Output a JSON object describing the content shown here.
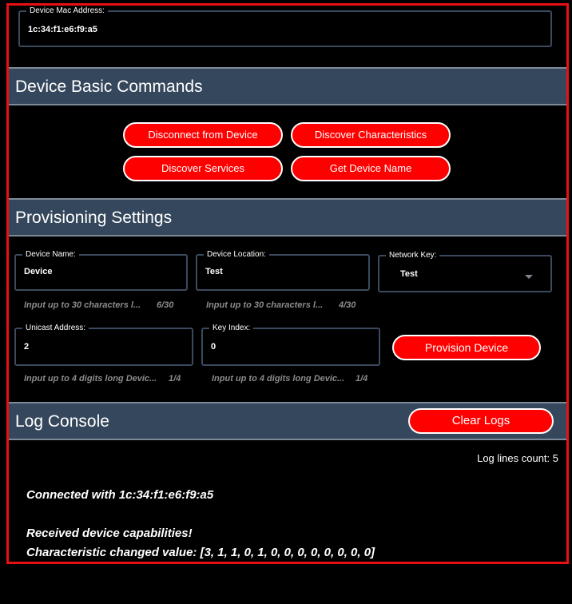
{
  "device": {
    "mac_label": "Device Mac Address:",
    "mac_value": "1c:34:f1:e6:f9:a5"
  },
  "basic_commands": {
    "title": "Device Basic Commands",
    "disconnect": "Disconnect from Device",
    "discover_characteristics": "Discover Characteristics",
    "discover_services": "Discover Services",
    "get_device_name": "Get Device Name"
  },
  "provisioning": {
    "title": "Provisioning Settings",
    "device_name": {
      "label": "Device Name:",
      "value": "Device",
      "helper": "Input up to 30 characters l...",
      "count": "6/30"
    },
    "device_location": {
      "label": "Device Location:",
      "value": "Test",
      "helper": "Input up to 30 characters l...",
      "count": "4/30"
    },
    "network_key": {
      "label": "Network Key:",
      "value": "Test"
    },
    "unicast_address": {
      "label": "Unicast Address:",
      "value": "2",
      "helper": "Input up to 4 digits long Devic...",
      "count": "1/4"
    },
    "key_index": {
      "label": "Key Index:",
      "value": "0",
      "helper": "Input up to 4 digits long Devic...",
      "count": "1/4"
    },
    "provision_button": "Provision Device"
  },
  "log_console": {
    "title": "Log Console",
    "clear_button": "Clear Logs",
    "count_text": "Log lines count: 5",
    "lines": [
      "Connected with 1c:34:f1:e6:f9:a5",
      "Received device capabilities!",
      "Characteristic changed value: [3, 1, 1, 0, 1, 0, 0, 0, 0, 0, 0, 0, 0]"
    ]
  },
  "colors": {
    "accent": "#ff0000",
    "header_bg": "#35475c",
    "frame_border": "#e81010"
  }
}
